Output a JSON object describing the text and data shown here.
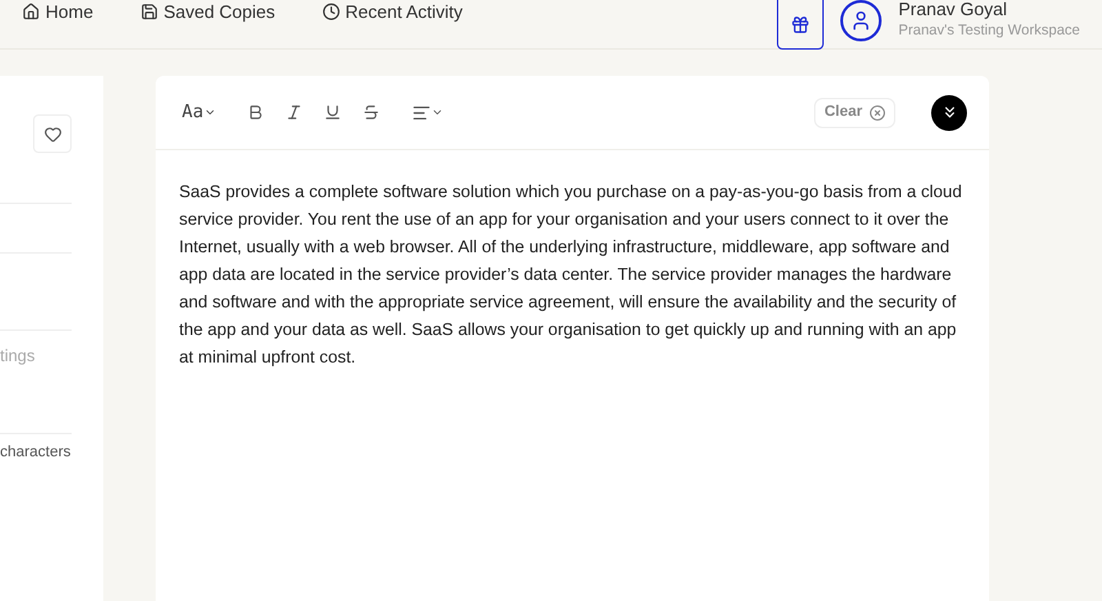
{
  "nav": [
    {
      "label": "Home"
    },
    {
      "label": "Saved Copies"
    },
    {
      "label": "Recent Activity"
    }
  ],
  "user": {
    "name": "Pranav Goyal",
    "workspace": "Pranav's Testing Workspace"
  },
  "side_panel": {
    "field_placeholder": "tings",
    "counter": "characters"
  },
  "toolbar": {
    "font_label": "Aa",
    "clear": "Clear"
  },
  "editor": {
    "text": "SaaS provides a complete software solution which you purchase on a pay-as-you-go basis from a cloud service provider. You rent the use of an app for your organisation and your users connect to it over the Internet, usually with a web browser. All of the underlying infrastructure, middleware, app software and app data are located in the service provider’s data center. The service provider manages the hardware and software and with the appropriate service agreement, will ensure the availability and the security of the app and your data as well. SaaS allows your organisation to get quickly up and running with an app at minimal upfront cost."
  }
}
